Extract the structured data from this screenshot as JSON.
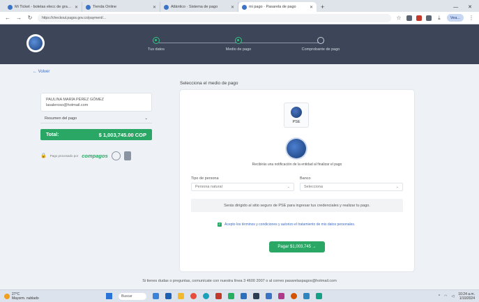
{
  "browser": {
    "tabs": [
      {
        "label": "Mi Ticket - boletas elecc de grandes",
        "active": false
      },
      {
        "label": "Tienda Online",
        "active": false
      },
      {
        "label": "Atlántico · Sistema de pago",
        "active": false
      },
      {
        "label": "mi pago · Pasarela de pago",
        "active": true
      }
    ],
    "url": "https://checkout.pagos.gov.co/payment/...",
    "profile_label": "Vea..."
  },
  "stepper": {
    "steps": [
      {
        "label": "Tus datos",
        "state": "done"
      },
      {
        "label": "Medio de pago",
        "state": "done"
      },
      {
        "label": "Comprobante de pago",
        "state": "pending"
      }
    ]
  },
  "back_label": "← Volver",
  "payer": {
    "name": "PAULINA MARÍA PÉREZ GÓMEZ",
    "email": "lasaleroso@hotmail.com"
  },
  "summary_label": "Resumen del pago",
  "total": {
    "label": "Total:",
    "value": "$ 1,003,745.00 COP"
  },
  "trust": {
    "processed_by": "Pago procesado por",
    "brand": "compagos"
  },
  "main": {
    "section_title": "Selecciona el medio de pago",
    "pse_tile_label": "PSE",
    "redirect_note": "Recibirás una notificación de la entidad al finalizar el pago",
    "person_type_label": "Tipo de persona",
    "person_type_value": "Persona natural",
    "bank_label": "Banco",
    "bank_value": "Selecciona",
    "info_text": "Serás dirigido al sitio seguro de PSE para ingresar tus credenciales y realizar tu pago.",
    "terms_text": "Acepto los términos y condiciones y autorizo el tratamiento de mis datos personales.",
    "pay_button": "Pagar $1,003,745 →"
  },
  "footer": "Si tienes dudas o preguntas, comunícate con nuestra línea 3 4600 2007 o al correo pasarelaspagos@hotmail.com",
  "taskbar": {
    "weather_temp": "27°C",
    "weather_desc": "Mayorm. nublado",
    "search_placeholder": "Buscar",
    "time": "10:24 a.m.",
    "date": "1/10/2024"
  }
}
